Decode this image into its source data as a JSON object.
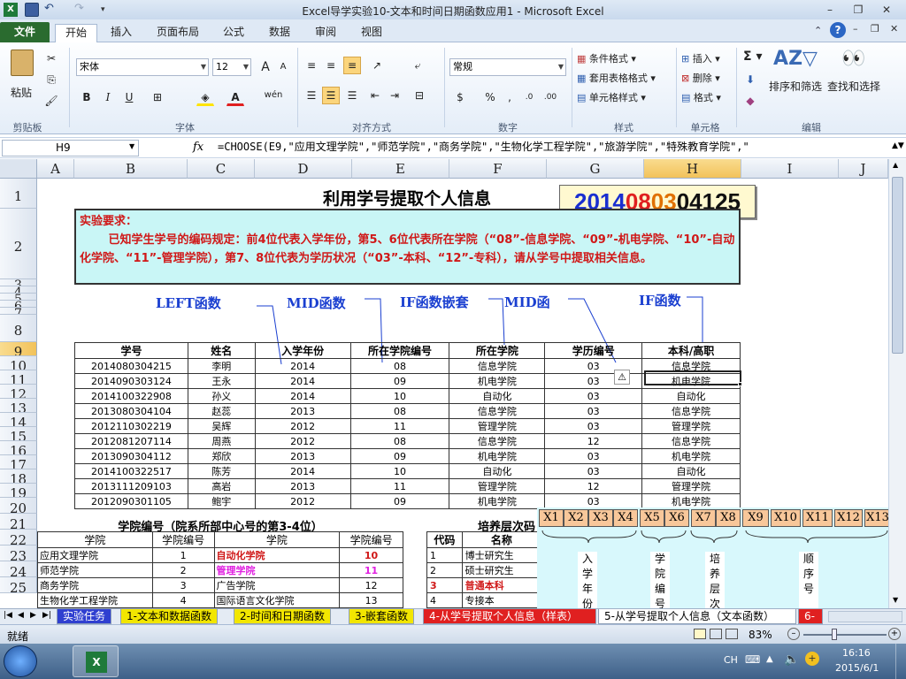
{
  "window": {
    "title": "Excel导学实验10-文本和时间日期函数应用1  -  Microsoft Excel",
    "min": "–",
    "max": "❐",
    "close": "✕"
  },
  "tabs": [
    "文件",
    "开始",
    "插入",
    "页面布局",
    "公式",
    "数据",
    "审阅",
    "视图"
  ],
  "active_tab": "开始",
  "ribbon": {
    "clipboard": {
      "paste": "粘贴",
      "group": "剪贴板"
    },
    "font": {
      "name": "宋体",
      "size": "12",
      "bold": "B",
      "italic": "I",
      "underline": "U",
      "group": "字体",
      "grow": "A",
      "shrink": "A",
      "wen": "wén"
    },
    "align": {
      "group": "对齐方式"
    },
    "number": {
      "format": "常规",
      "percent": "%",
      "comma": ",",
      "group": "数字"
    },
    "styles": {
      "cond": "条件格式",
      "table": "套用表格格式",
      "cell": "单元格样式",
      "group": "样式"
    },
    "cells": {
      "insert": "插入",
      "delete": "删除",
      "format": "格式",
      "group": "单元格"
    },
    "editing": {
      "sum": "Σ",
      "sort": "排序和筛选",
      "find": "查找和选择",
      "group": "编辑"
    }
  },
  "formula_bar": {
    "name_box": "H9",
    "fx": "fx",
    "formula": "=CHOOSE(E9,\"应用文理学院\",\"师范学院\",\"商务学院\",\"生物化学工程学院\",\"旅游学院\",\"特殊教育学院\",\""
  },
  "columns": [
    "A",
    "B",
    "C",
    "D",
    "E",
    "F",
    "G",
    "H",
    "I",
    "J"
  ],
  "rows": [
    "1",
    "2",
    "3",
    "4",
    "5",
    "6",
    "7",
    "8",
    "9",
    "10",
    "11",
    "12",
    "13",
    "14",
    "15",
    "16",
    "17",
    "18",
    "19",
    "20",
    "21",
    "22",
    "23",
    "24",
    "25"
  ],
  "sheet": {
    "title": "利用学号提取个人信息",
    "student_no": {
      "p1": "2014",
      "p2": "08",
      "p3": "03",
      "p4": "04125"
    },
    "requirement": {
      "title": "实验要求：",
      "body": "已知学生学号的编码规定：前4位代表入学年份，第5、6位代表所在学院（“08”-信息学院、“09”-机电学院、“10”-自动化学院、“11”-管理学院），第7、8位代表为学历状况（“03”-本科、“12”-专科），请从学号中提取相关信息。"
    },
    "annotations": [
      "LEFT函数",
      "MID函数",
      "IF函数嵌套",
      "MID函",
      "IF函数"
    ],
    "headers": [
      "学号",
      "姓名",
      "入学年份",
      "所在学院编号",
      "所在学院",
      "学历编号",
      "本科/高职"
    ],
    "records": [
      [
        "2014080304215",
        "李明",
        "2014",
        "08",
        "信息学院",
        "03",
        "信息学院"
      ],
      [
        "2014090303124",
        "王永",
        "2014",
        "09",
        "机电学院",
        "03",
        "机电学院"
      ],
      [
        "2014100322908",
        "孙义",
        "2014",
        "10",
        "自动化",
        "03",
        "自动化"
      ],
      [
        "2013080304104",
        "赵蕊",
        "2013",
        "08",
        "信息学院",
        "03",
        "信息学院"
      ],
      [
        "2012110302219",
        "吴辉",
        "2012",
        "11",
        "管理学院",
        "03",
        "管理学院"
      ],
      [
        "2012081207114",
        "周燕",
        "2012",
        "08",
        "信息学院",
        "12",
        "信息学院"
      ],
      [
        "2013090304112",
        "郑欣",
        "2013",
        "09",
        "机电学院",
        "03",
        "机电学院"
      ],
      [
        "2014100322517",
        "陈芳",
        "2014",
        "10",
        "自动化",
        "03",
        "自动化"
      ],
      [
        "2013111209103",
        "高岩",
        "2013",
        "11",
        "管理学院",
        "12",
        "管理学院"
      ],
      [
        "2012090301105",
        "鲍宇",
        "2012",
        "09",
        "机电学院",
        "03",
        "机电学院"
      ]
    ],
    "college_table": {
      "title": "学院编号（院系所部中心号的第3-4位）",
      "headers": [
        "学院",
        "学院编号",
        "学院",
        "学院编号"
      ],
      "rows": [
        [
          "应用文理学院",
          "1",
          "自动化学院",
          "10"
        ],
        [
          "师范学院",
          "2",
          "管理学院",
          "11"
        ],
        [
          "商务学院",
          "3",
          "广告学院",
          "12"
        ],
        [
          "生物化学工程学院",
          "4",
          "国际语言文化学院",
          "13"
        ]
      ]
    },
    "level_table": {
      "title": "培养层次码",
      "headers": [
        "代码",
        "名称"
      ],
      "rows": [
        [
          "1",
          "博士研究生"
        ],
        [
          "2",
          "硕士研究生"
        ],
        [
          "3",
          "普通本科"
        ],
        [
          "4",
          "专接本"
        ]
      ]
    },
    "diagram": {
      "boxes": [
        "X1",
        "X2",
        "X3",
        "X4",
        "X5",
        "X6",
        "X7",
        "X8",
        "X9",
        "X10",
        "X11",
        "X12",
        "X13"
      ],
      "labels": [
        "入学年份",
        "学院编号",
        "培养层次",
        "顺序号"
      ]
    }
  },
  "sheet_tabs": [
    "实验任务",
    "1-文本和数据函数",
    "2-时间和日期函数",
    "3-嵌套函数",
    "4-从学号提取个人信息（样表）",
    "5-从学号提取个人信息（文本函数）",
    "6-"
  ],
  "active_sheet": "5-从学号提取个人信息（文本函数）",
  "status": {
    "mode": "就绪",
    "zoom": "83%"
  },
  "taskbar": {
    "lang": "CH",
    "time": "16:16",
    "date": "2015/6/1"
  },
  "colors": {
    "excel_green": "#2a6b2f",
    "red": "#d01818",
    "blue": "#1a3fd0",
    "note_bg": "#c9f6f6",
    "magenta": "#e020e0"
  }
}
